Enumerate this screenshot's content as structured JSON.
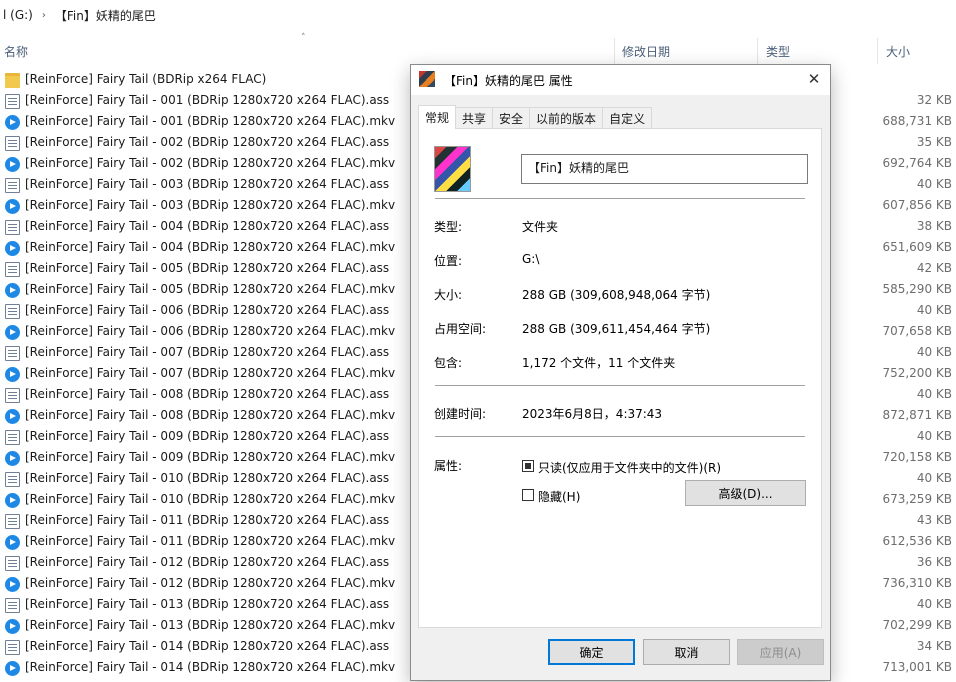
{
  "breadcrumb": {
    "drive": "l (G:)",
    "folder": "【Fin】妖精的尾巴"
  },
  "columns": {
    "name": "名称",
    "date": "修改日期",
    "type": "类型",
    "size": "大小"
  },
  "files": [
    {
      "name": "[ReinForce] Fairy Tail (BDRip x264 FLAC)",
      "size": "",
      "kind": "folder"
    },
    {
      "name": "[ReinForce] Fairy Tail - 001 (BDRip 1280x720 x264 FLAC).ass",
      "size": "32 KB",
      "kind": "ass"
    },
    {
      "name": "[ReinForce] Fairy Tail - 001 (BDRip 1280x720 x264 FLAC).mkv",
      "size": "688,731 KB",
      "kind": "mkv"
    },
    {
      "name": "[ReinForce] Fairy Tail - 002 (BDRip 1280x720 x264 FLAC).ass",
      "size": "35 KB",
      "kind": "ass"
    },
    {
      "name": "[ReinForce] Fairy Tail - 002 (BDRip 1280x720 x264 FLAC).mkv",
      "size": "692,764 KB",
      "kind": "mkv"
    },
    {
      "name": "[ReinForce] Fairy Tail - 003 (BDRip 1280x720 x264 FLAC).ass",
      "size": "40 KB",
      "kind": "ass"
    },
    {
      "name": "[ReinForce] Fairy Tail - 003 (BDRip 1280x720 x264 FLAC).mkv",
      "size": "607,856 KB",
      "kind": "mkv"
    },
    {
      "name": "[ReinForce] Fairy Tail - 004 (BDRip 1280x720 x264 FLAC).ass",
      "size": "38 KB",
      "kind": "ass"
    },
    {
      "name": "[ReinForce] Fairy Tail - 004 (BDRip 1280x720 x264 FLAC).mkv",
      "size": "651,609 KB",
      "kind": "mkv"
    },
    {
      "name": "[ReinForce] Fairy Tail - 005 (BDRip 1280x720 x264 FLAC).ass",
      "size": "42 KB",
      "kind": "ass"
    },
    {
      "name": "[ReinForce] Fairy Tail - 005 (BDRip 1280x720 x264 FLAC).mkv",
      "size": "585,290 KB",
      "kind": "mkv"
    },
    {
      "name": "[ReinForce] Fairy Tail - 006 (BDRip 1280x720 x264 FLAC).ass",
      "size": "40 KB",
      "kind": "ass"
    },
    {
      "name": "[ReinForce] Fairy Tail - 006 (BDRip 1280x720 x264 FLAC).mkv",
      "size": "707,658 KB",
      "kind": "mkv"
    },
    {
      "name": "[ReinForce] Fairy Tail - 007 (BDRip 1280x720 x264 FLAC).ass",
      "size": "40 KB",
      "kind": "ass"
    },
    {
      "name": "[ReinForce] Fairy Tail - 007 (BDRip 1280x720 x264 FLAC).mkv",
      "size": "752,200 KB",
      "kind": "mkv"
    },
    {
      "name": "[ReinForce] Fairy Tail - 008 (BDRip 1280x720 x264 FLAC).ass",
      "size": "40 KB",
      "kind": "ass"
    },
    {
      "name": "[ReinForce] Fairy Tail - 008 (BDRip 1280x720 x264 FLAC).mkv",
      "size": "872,871 KB",
      "kind": "mkv"
    },
    {
      "name": "[ReinForce] Fairy Tail - 009 (BDRip 1280x720 x264 FLAC).ass",
      "size": "40 KB",
      "kind": "ass"
    },
    {
      "name": "[ReinForce] Fairy Tail - 009 (BDRip 1280x720 x264 FLAC).mkv",
      "size": "720,158 KB",
      "kind": "mkv"
    },
    {
      "name": "[ReinForce] Fairy Tail - 010 (BDRip 1280x720 x264 FLAC).ass",
      "size": "40 KB",
      "kind": "ass"
    },
    {
      "name": "[ReinForce] Fairy Tail - 010 (BDRip 1280x720 x264 FLAC).mkv",
      "size": "673,259 KB",
      "kind": "mkv"
    },
    {
      "name": "[ReinForce] Fairy Tail - 011 (BDRip 1280x720 x264 FLAC).ass",
      "size": "43 KB",
      "kind": "ass"
    },
    {
      "name": "[ReinForce] Fairy Tail - 011 (BDRip 1280x720 x264 FLAC).mkv",
      "size": "612,536 KB",
      "kind": "mkv"
    },
    {
      "name": "[ReinForce] Fairy Tail - 012 (BDRip 1280x720 x264 FLAC).ass",
      "size": "36 KB",
      "kind": "ass"
    },
    {
      "name": "[ReinForce] Fairy Tail - 012 (BDRip 1280x720 x264 FLAC).mkv",
      "size": "736,310 KB",
      "kind": "mkv"
    },
    {
      "name": "[ReinForce] Fairy Tail - 013 (BDRip 1280x720 x264 FLAC).ass",
      "size": "40 KB",
      "kind": "ass"
    },
    {
      "name": "[ReinForce] Fairy Tail - 013 (BDRip 1280x720 x264 FLAC).mkv",
      "size": "702,299 KB",
      "kind": "mkv"
    },
    {
      "name": "[ReinForce] Fairy Tail - 014 (BDRip 1280x720 x264 FLAC).ass",
      "size": "34 KB",
      "kind": "ass"
    },
    {
      "name": "[ReinForce] Fairy Tail - 014 (BDRip 1280x720 x264 FLAC).mkv",
      "size": "713,001 KB",
      "kind": "mkv"
    }
  ],
  "dialog": {
    "title": "【Fin】妖精的尾巴 属性",
    "tabs": [
      "常规",
      "共享",
      "安全",
      "以前的版本",
      "自定义"
    ],
    "folder_name": "【Fin】妖精的尾巴",
    "props": {
      "type_label": "类型:",
      "type_value": "文件夹",
      "location_label": "位置:",
      "location_value": "G:\\",
      "size_label": "大小:",
      "size_value": "288 GB (309,608,948,064 字节)",
      "disk_label": "占用空间:",
      "disk_value": "288 GB (309,611,454,464 字节)",
      "contains_label": "包含:",
      "contains_value": "1,172 个文件，11 个文件夹",
      "created_label": "创建时间:",
      "created_value": "2023年6月8日，4:37:43",
      "attr_label": "属性:"
    },
    "readonly_label": "只读(仅应用于文件夹中的文件)(R)",
    "readonly_checked": true,
    "hidden_label": "隐藏(H)",
    "hidden_checked": false,
    "advanced_button": "高级(D)...",
    "ok_button": "确定",
    "cancel_button": "取消",
    "apply_button": "应用(A)"
  }
}
